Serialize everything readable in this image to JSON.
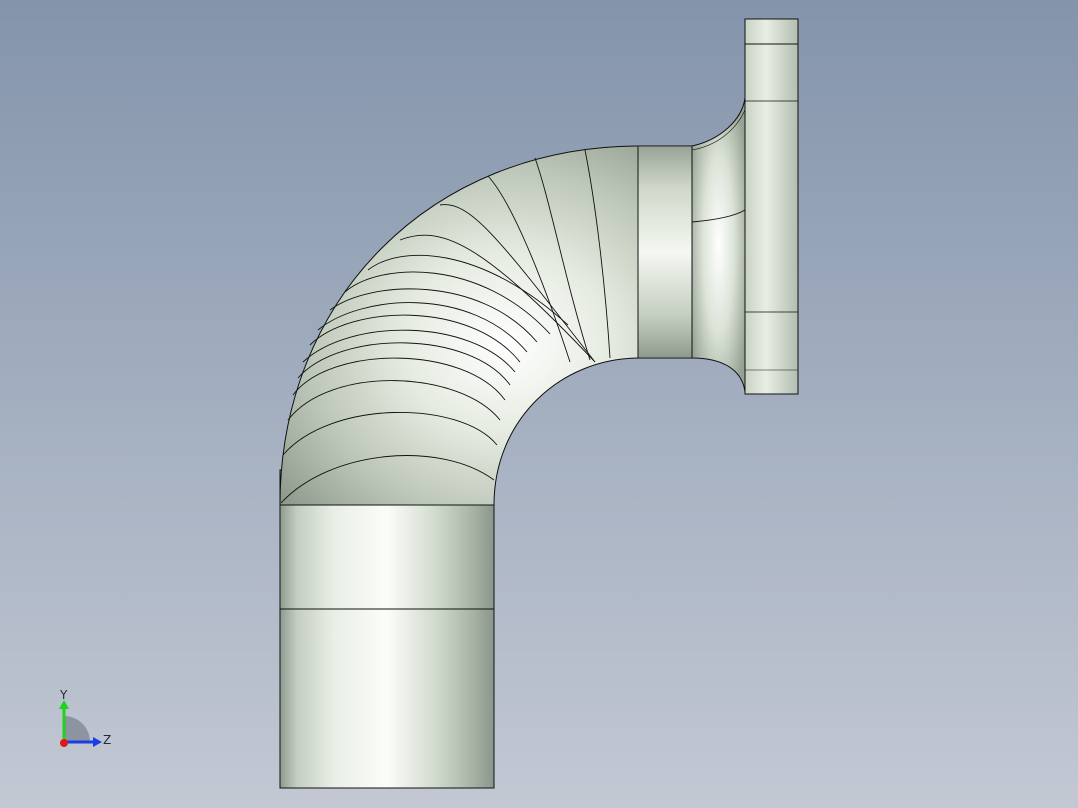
{
  "viewport": {
    "background_top": "#8494ab",
    "background_bottom": "#c3c8d3"
  },
  "model": {
    "description_icon": "pipe-elbow-with-flange",
    "surface_color": "#d9e2d6",
    "edge_color": "#111111"
  },
  "triad": {
    "y_label": "Y",
    "z_label": "Z",
    "y_color": "#1ed21e",
    "z_color": "#1a3ee6",
    "x_color": "#e01818"
  }
}
